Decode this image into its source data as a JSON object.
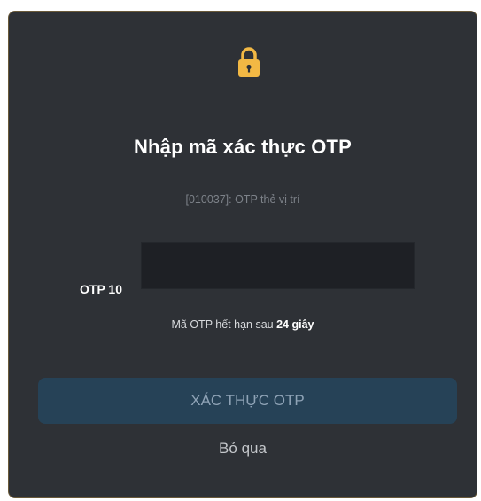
{
  "dialog": {
    "icon": "lock-icon",
    "title": "Nhập mã xác thực OTP",
    "subtitle": "[010037]: OTP thẻ vị trí",
    "otp_label": "OTP 10",
    "otp_value": "",
    "expire_prefix": "Mã OTP hết hạn sau",
    "expire_seconds": "24 giây",
    "verify_label": "XÁC THỰC OTP",
    "skip_label": "Bỏ qua"
  },
  "colors": {
    "background": "#2e3136",
    "input_bg": "#1e2025",
    "button_bg": "#264257",
    "button_text": "#8fa3b6",
    "lock": "#f2b844"
  }
}
